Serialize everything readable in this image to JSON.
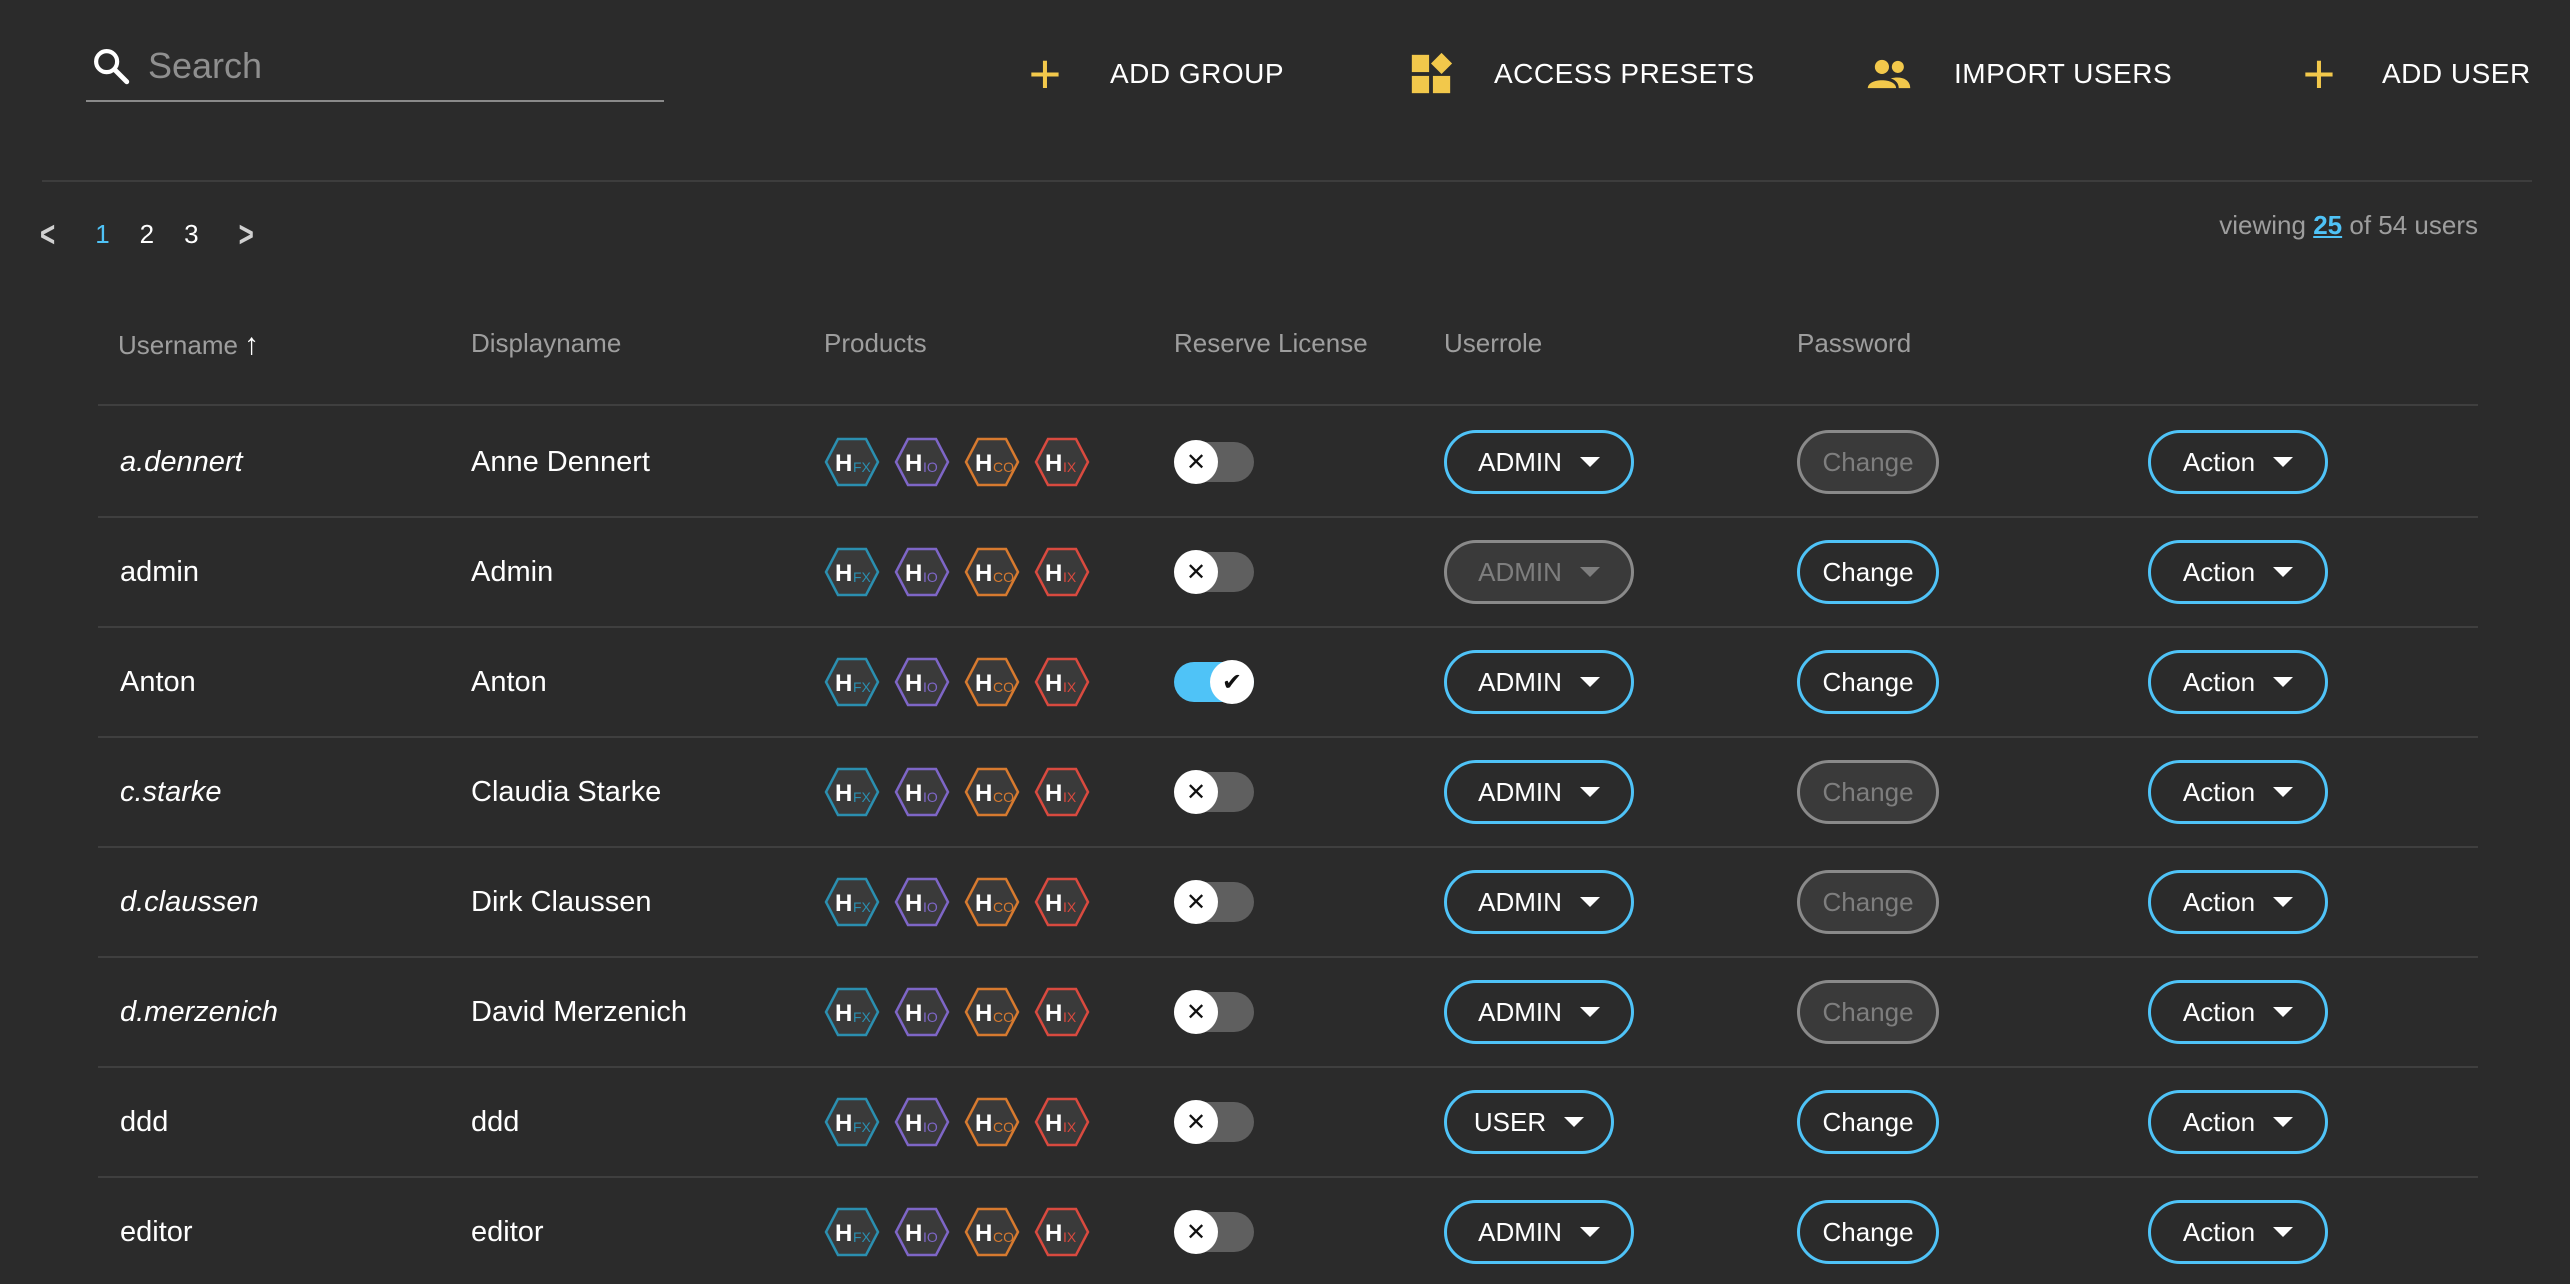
{
  "search": {
    "placeholder": "Search"
  },
  "toolbar": {
    "add_group": "ADD GROUP",
    "access_presets": "ACCESS PRESETS",
    "import_users": "IMPORT USERS",
    "add_user": "ADD USER"
  },
  "pagination": {
    "pages": [
      "1",
      "2",
      "3"
    ],
    "current": "1",
    "viewing_prefix": "viewing",
    "viewing_count": "25",
    "viewing_suffix": "of 54 users"
  },
  "table": {
    "headers": {
      "username": "Username",
      "displayname": "Displayname",
      "products": "Products",
      "reserve_license": "Reserve License",
      "userrole": "Userrole",
      "password": "Password"
    },
    "products": [
      {
        "letter": "H",
        "sub": "FX",
        "color": "#2b8fb0"
      },
      {
        "letter": "H",
        "sub": "IO",
        "color": "#7e66c7"
      },
      {
        "letter": "H",
        "sub": "CO",
        "color": "#d77a2f"
      },
      {
        "letter": "H",
        "sub": "IX",
        "color": "#d94a3f"
      }
    ],
    "rows": [
      {
        "username": "a.dennert",
        "displayname": "Anne Dennert",
        "italic": true,
        "reserve": false,
        "role": "ADMIN",
        "role_disabled": false,
        "password": "Change",
        "password_disabled": true,
        "action": "Action"
      },
      {
        "username": "admin",
        "displayname": "Admin",
        "italic": false,
        "reserve": false,
        "role": "ADMIN",
        "role_disabled": true,
        "password": "Change",
        "password_disabled": false,
        "action": "Action"
      },
      {
        "username": "Anton",
        "displayname": "Anton",
        "italic": false,
        "reserve": true,
        "role": "ADMIN",
        "role_disabled": false,
        "password": "Change",
        "password_disabled": false,
        "action": "Action"
      },
      {
        "username": "c.starke",
        "displayname": "Claudia Starke",
        "italic": true,
        "reserve": false,
        "role": "ADMIN",
        "role_disabled": false,
        "password": "Change",
        "password_disabled": true,
        "action": "Action"
      },
      {
        "username": "d.claussen",
        "displayname": "Dirk Claussen",
        "italic": true,
        "reserve": false,
        "role": "ADMIN",
        "role_disabled": false,
        "password": "Change",
        "password_disabled": true,
        "action": "Action"
      },
      {
        "username": "d.merzenich",
        "displayname": "David Merzenich",
        "italic": true,
        "reserve": false,
        "role": "ADMIN",
        "role_disabled": false,
        "password": "Change",
        "password_disabled": true,
        "action": "Action"
      },
      {
        "username": "ddd",
        "displayname": "ddd",
        "italic": false,
        "reserve": false,
        "role": "USER",
        "role_disabled": false,
        "password": "Change",
        "password_disabled": false,
        "action": "Action"
      },
      {
        "username": "editor",
        "displayname": "editor",
        "italic": false,
        "reserve": false,
        "role": "ADMIN",
        "role_disabled": false,
        "password": "Change",
        "password_disabled": false,
        "action": "Action"
      }
    ]
  },
  "colors": {
    "accent": "#4fc3f7",
    "icon_yellow": "#f2c84b",
    "background": "#2b2b2b"
  }
}
